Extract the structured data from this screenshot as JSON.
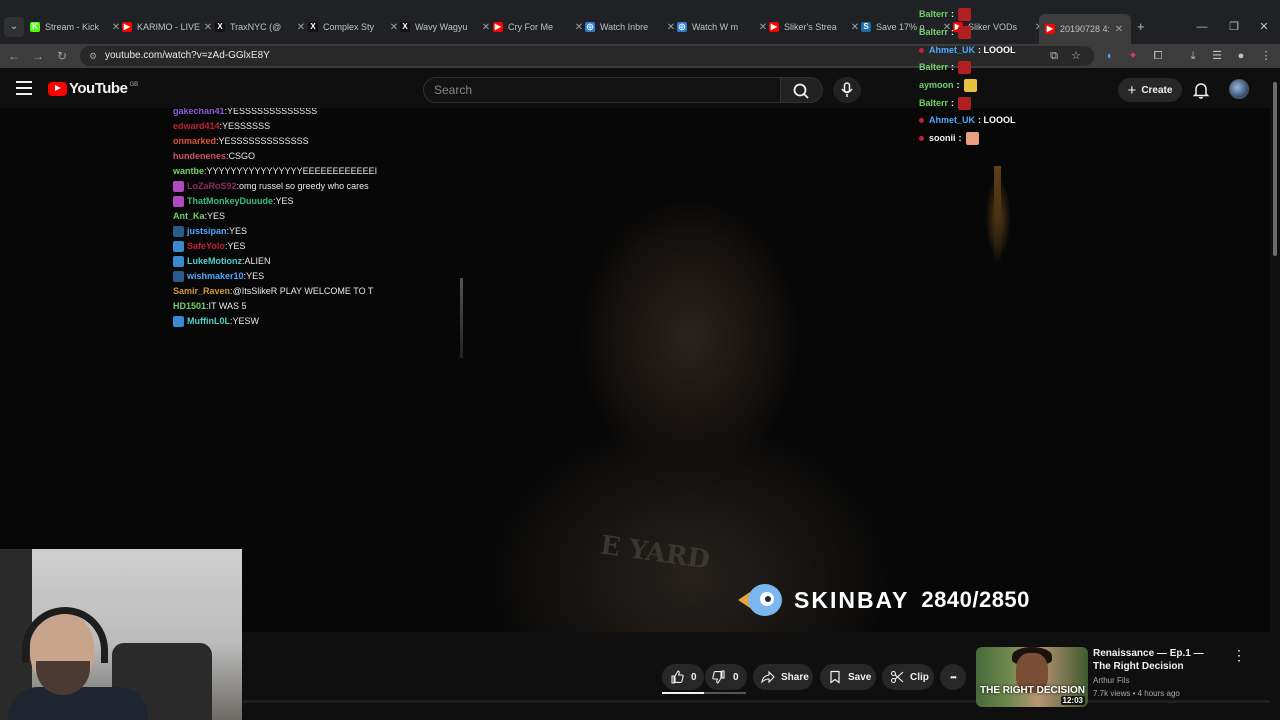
{
  "browser": {
    "tabs": [
      {
        "label": "Stream - Kick",
        "fav": "K",
        "color": "#53fc18"
      },
      {
        "label": "KARIMO - LIVE",
        "fav": "▶",
        "color": "#ff0000"
      },
      {
        "label": "TraxNYC (@",
        "fav": "X",
        "color": "#111111"
      },
      {
        "label": "Complex Sty",
        "fav": "X",
        "color": "#111111"
      },
      {
        "label": "Wavy Wagyu",
        "fav": "X",
        "color": "#111111"
      },
      {
        "label": "Cry For Me",
        "fav": "▶",
        "color": "#ff0000"
      },
      {
        "label": "Watch Inbre",
        "fav": "◎",
        "color": "#2d7fd6"
      },
      {
        "label": "Watch W m",
        "fav": "◎",
        "color": "#2d7fd6"
      },
      {
        "label": "Sliker's Strea",
        "fav": "▶",
        "color": "#ff0000"
      },
      {
        "label": "Save 17% o",
        "fav": "S",
        "color": "#1b6fa8"
      },
      {
        "label": "Sliker VODs",
        "fav": "▶",
        "color": "#ff0000"
      },
      {
        "label": "20190728 4:",
        "fav": "▶",
        "color": "#ff0000",
        "active": true
      }
    ],
    "new_tab": "+",
    "url": "youtube.com/watch?v=zAd-GGlxE8Y"
  },
  "youtube": {
    "logo_text": "YouTube",
    "region": "GB",
    "search_placeholder": "Search",
    "create_label": "Create"
  },
  "chat_left": [
    {
      "user": "gakechan41",
      "msg": "YESSSSSSSSSSSSS",
      "color": "#8a5cd8",
      "badge": ""
    },
    {
      "user": "edward414",
      "msg": "YESSSSSS",
      "color": "#c0203a",
      "badge": ""
    },
    {
      "user": "onmarked",
      "msg": "YESSSSSSSSSSSSS",
      "color": "#e0503a",
      "badge": ""
    },
    {
      "user": "hundenenes",
      "msg": "CSGO",
      "color": "#d0506a",
      "badge": ""
    },
    {
      "user": "wantbe",
      "msg": "YYYYYYYYYYYYYYYYEEEEEEEEEEEEI",
      "color": "#6fd16a",
      "badge": ""
    },
    {
      "user": "LoZaRoS92",
      "msg": "omg russel so greedy who cares",
      "color": "#8a2a5a",
      "badge": "#b04ac0"
    },
    {
      "user": "ThatMonkeyDuuude",
      "msg": "YES",
      "color": "#35c07a",
      "badge": "#b04ac0"
    },
    {
      "user": "Ant_Ka",
      "msg": "YES",
      "color": "#6fd16a",
      "badge": ""
    },
    {
      "user": "justsipan",
      "msg": "YES",
      "color": "#4fa8ff",
      "badge": "#2a5a8a"
    },
    {
      "user": "SafeYolo",
      "msg": "YES",
      "color": "#c0203a",
      "badge": "#3a8ad0"
    },
    {
      "user": "LukeMotionz",
      "msg": "ALIEN",
      "color": "#4fd0c8",
      "badge": "#3a8ad0"
    },
    {
      "user": "wishmaker10",
      "msg": "YES",
      "color": "#4fa8ff",
      "badge": "#2a5a8a"
    },
    {
      "user": "Samir_Raven",
      "msg": "@ItsSlikeR PLAY WELCOME TO T",
      "color": "#d09a3a",
      "badge": ""
    },
    {
      "user": "HD1501",
      "msg": "IT WAS 5",
      "color": "#6fd16a",
      "badge": ""
    },
    {
      "user": "MuffinL0L",
      "msg": "YESW",
      "color": "#4fd0c8",
      "badge": "#3a8ad0"
    }
  ],
  "chat_right": [
    {
      "user": "Balterr",
      "msg": ":",
      "color": "#6fd16a",
      "emote": "#b02020",
      "dot": false
    },
    {
      "user": "Balterr",
      "msg": ":",
      "color": "#6fd16a",
      "emote": "#b02020",
      "dot": false
    },
    {
      "user": "Ahmet_UK",
      "msg": ": LOOOL",
      "color": "#4fa8ff",
      "emote": "",
      "dot": true
    },
    {
      "user": "Balterr",
      "msg": ":",
      "color": "#6fd16a",
      "emote": "#b02020",
      "dot": false
    },
    {
      "user": "aymoon",
      "msg": ":",
      "color": "#6fd16a",
      "emote": "#e8c040",
      "dot": false
    },
    {
      "user": "Balterr",
      "msg": ":",
      "color": "#6fd16a",
      "emote": "#b02020",
      "dot": false
    },
    {
      "user": "Ahmet_UK",
      "msg": ": LOOOL",
      "color": "#4fa8ff",
      "emote": "",
      "dot": true
    },
    {
      "user": "soonii",
      "msg": ":",
      "color": "#f1f1f1",
      "emote": "#e8a080",
      "dot": true
    }
  ],
  "overlay": {
    "brand": "SKINBAY",
    "count": "2840/2850",
    "shirt_text": "E YARD"
  },
  "actions": {
    "like_count": "0",
    "dislike_count": "0",
    "share_label": "Share",
    "save_label": "Save",
    "clip_label": "Clip",
    "more_label": "•••",
    "progress_fraction": 0.5
  },
  "recommended": {
    "title": "Renaissance — Ep.1 — The Right Decision",
    "channel": "Arthur Fils",
    "meta": "7.7k views • 4 hours ago",
    "thumb_caption": "THE RIGHT DECISION",
    "duration": "12:03"
  }
}
